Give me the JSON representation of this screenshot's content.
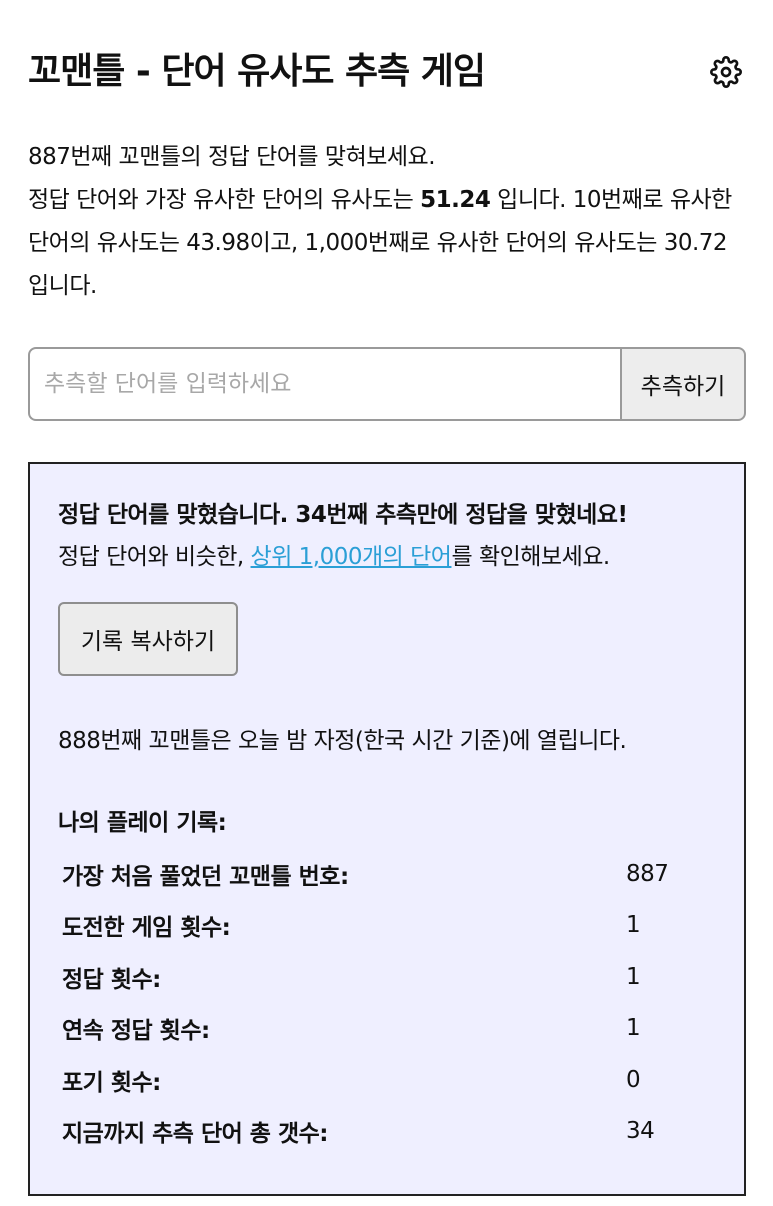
{
  "header": {
    "title": "꼬맨틀 - 단어 유사도 추측 게임",
    "settings_icon": "gear-icon"
  },
  "intro": {
    "line1": "887번째 꼬맨틀의 정답 단어를 맞혀보세요.",
    "line2_prefix": "정답 단어와 가장 유사한 단어의 유사도는 ",
    "top_similarity": "51.24",
    "line2_suffix": " 입니다. 10번째로 유사한 단어의 유사도는 43.98이고, 1,000번째로 유사한 단어의 유사도는 30.72 입니다."
  },
  "guess": {
    "value": "",
    "placeholder": "추측할 단어를 입력하세요",
    "button_label": "추측하기"
  },
  "result": {
    "success_message": "정답 단어를 맞혔습니다. 34번째 추측만에 정답을 맞혔네요!",
    "similar_prefix": "정답 단어와 비슷한, ",
    "similar_link": "상위 1,000개의 단어",
    "similar_suffix": "를 확인해보세요.",
    "copy_button_label": "기록 복사하기",
    "next_game_notice": "888번째 꼬맨틀은 오늘 밤 자정(한국 시간 기준)에 열립니다."
  },
  "stats": {
    "title": "나의 플레이 기록:",
    "rows": [
      {
        "label": "가장 처음 풀었던 꼬맨틀 번호:",
        "value": "887"
      },
      {
        "label": "도전한 게임 횟수:",
        "value": "1"
      },
      {
        "label": "정답 횟수:",
        "value": "1"
      },
      {
        "label": "연속 정답 횟수:",
        "value": "1"
      },
      {
        "label": "포기 횟수:",
        "value": "0"
      },
      {
        "label": "지금까지 추측 단어 총 갯수:",
        "value": "34"
      }
    ]
  },
  "colors": {
    "result_background": "#efefff",
    "link": "#2b9fd6",
    "border": "#222222"
  }
}
